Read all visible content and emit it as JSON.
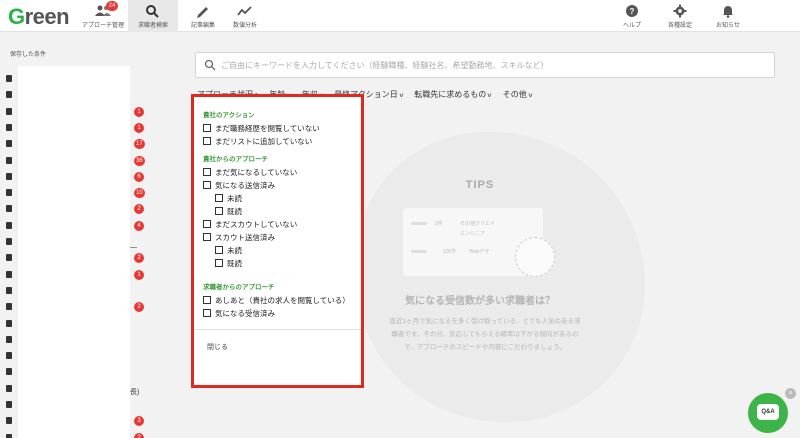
{
  "app": {
    "logo_g": "G",
    "logo_rest": "reen",
    "brand_color": "#2bb24c"
  },
  "nav": {
    "items": [
      {
        "label": "アプローチ管理",
        "icon": "people-icon",
        "badge": "24"
      },
      {
        "label": "求職者検索",
        "icon": "search-icon",
        "active": true
      },
      {
        "label": "記事編集",
        "icon": "pencil-icon"
      },
      {
        "label": "数値分析",
        "icon": "chart-line-icon"
      }
    ],
    "right": [
      {
        "label": "ヘルプ",
        "icon": "help-icon"
      },
      {
        "label": "各種設定",
        "icon": "gear-icon"
      },
      {
        "label": "お知らせ",
        "icon": "bell-icon"
      }
    ]
  },
  "sidebar": {
    "title": "保存した条件",
    "counts": [
      "",
      "",
      "1",
      "1",
      "17",
      "36",
      "6",
      "10",
      "2",
      "4",
      "",
      "2",
      "1",
      "",
      "2",
      "",
      "",
      "",
      "",
      "",
      "",
      "3",
      "2"
    ],
    "fragments": {
      "dash": "—",
      "paren": "長)"
    }
  },
  "search": {
    "placeholder": "ご自由にキーワードを入力してください（経験職種、経験社名、希望勤務地、スキルなど）",
    "value": ""
  },
  "filters": [
    {
      "label": "アプローチ状況",
      "chev": "^"
    },
    {
      "label": "年齢",
      "chev": "v"
    },
    {
      "label": "年収",
      "chev": "v"
    },
    {
      "label": "最終アクション日",
      "chev": "v"
    },
    {
      "label": "転職先に求めるもの",
      "chev": "v"
    },
    {
      "label": "その他",
      "chev": "v"
    }
  ],
  "dropdown": {
    "section1": "貴社のアクション",
    "s1_items": [
      "まだ職務経歴を閲覧していない",
      "まだリストに追加していない"
    ],
    "section2": "貴社からのアプローチ",
    "s2_items": [
      "まだ気になるしていない",
      "気になる送信済み",
      "未読",
      "既読",
      "まだスカウトしていない",
      "スカウト送信済み",
      "未読",
      "既読"
    ],
    "section3": "求職者からのアプローチ",
    "s3_items": [
      "あしあと（貴社の求人を閲覧している）",
      "気になる受信済み"
    ],
    "close": "閉じる"
  },
  "tips": {
    "title": "TIPS",
    "heading": "気になる受信数が多い求職者は？",
    "body": "直近1ヶ月で気になるを多く受け取っている、とても人気のある求\n職者です。その分、反応してもらえる確率は下がる傾向があるの\nで、アプローチのスピードや内容にこだわりましょう。",
    "mock_a": "5件",
    "mock_b": "100件",
    "mock_c": "その他クリエイ",
    "mock_d": "Webデザ",
    "mock_e": "エンジニア"
  },
  "qa": {
    "label": "Q&A",
    "close": "×"
  }
}
